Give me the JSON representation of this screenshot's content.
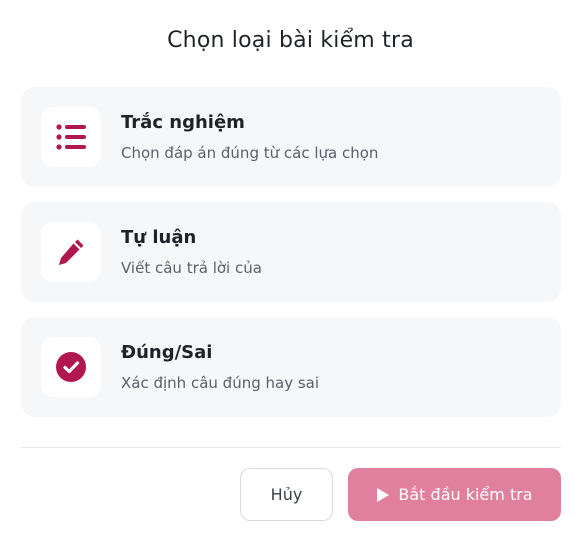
{
  "dialog": {
    "title": "Chọn loại bài kiểm tra"
  },
  "options": [
    {
      "title": "Trắc nghiệm",
      "description": "Chọn đáp án đúng từ các lựa chọn",
      "icon": "list-icon"
    },
    {
      "title": "Tự luận",
      "description": "Viết câu trả lời của",
      "icon": "pencil-icon"
    },
    {
      "title": "Đúng/Sai",
      "description": "Xác định câu đúng hay sai",
      "icon": "check-circle-icon"
    }
  ],
  "buttons": {
    "cancel_label": "Hủy",
    "start_label": "Bắt đầu kiểm tra"
  },
  "colors": {
    "accent": "#b0174f",
    "start_button_bg": "#e07f9e",
    "card_bg": "#f6f7f9"
  }
}
